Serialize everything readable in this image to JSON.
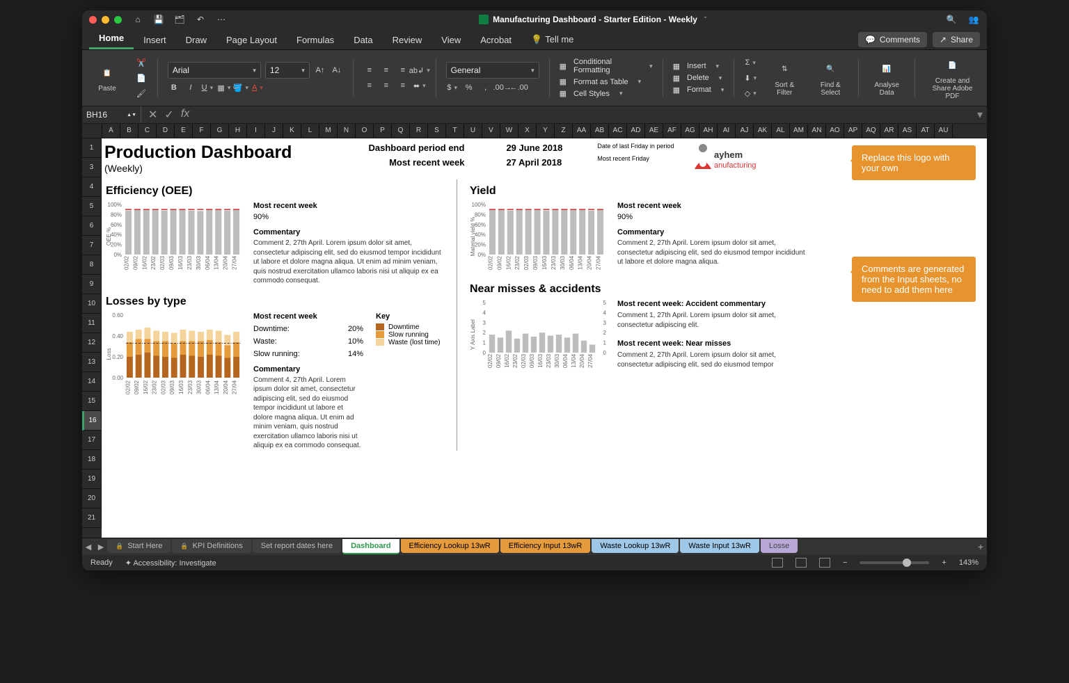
{
  "title_bar": {
    "doc_title": "Manufacturing Dashboard - Starter Edition - Weekly"
  },
  "ribbon_tabs": [
    "Home",
    "Insert",
    "Draw",
    "Page Layout",
    "Formulas",
    "Data",
    "Review",
    "View",
    "Acrobat",
    "Tell me"
  ],
  "ribbon": {
    "paste": "Paste",
    "font_name": "Arial",
    "font_size": "12",
    "number_format": "General",
    "cond_fmt": "Conditional Formatting",
    "fmt_table": "Format as Table",
    "cell_styles": "Cell Styles",
    "insert": "Insert",
    "delete": "Delete",
    "format": "Format",
    "sort_filter": "Sort & Filter",
    "find_select": "Find & Select",
    "analyse": "Analyse Data",
    "adobe": "Create and Share Adobe PDF",
    "comments_btn": "Comments",
    "share_btn": "Share"
  },
  "namebox": "BH16",
  "col_headers": [
    "A",
    "B",
    "C",
    "D",
    "E",
    "F",
    "G",
    "H",
    "I",
    "J",
    "K",
    "L",
    "M",
    "N",
    "O",
    "P",
    "Q",
    "R",
    "S",
    "T",
    "U",
    "V",
    "W",
    "X",
    "Y",
    "Z",
    "AA",
    "AB",
    "AC",
    "AD",
    "AE",
    "AF",
    "AG",
    "AH",
    "AI",
    "AJ",
    "AK",
    "AL",
    "AM",
    "AN",
    "AO",
    "AP",
    "AQ",
    "AR",
    "AS",
    "AT",
    "AU"
  ],
  "row_headers": [
    "1",
    "3",
    "4",
    "5",
    "6",
    "7",
    "8",
    "9",
    "10",
    "11",
    "12",
    "13",
    "14",
    "15",
    "16",
    "17",
    "18",
    "19",
    "20",
    "21"
  ],
  "dashboard": {
    "title": "Production Dashboard",
    "subtitle": "(Weekly)",
    "period_label": "Dashboard period end",
    "period_value": "29 June 2018",
    "period_note": "Date of last Friday in period",
    "recent_label": "Most recent week",
    "recent_value": "27 April 2018",
    "recent_note": "Most recent Friday",
    "logo_name": "ayhem",
    "logo_sub": "anufacturing",
    "callout_logo": "Replace this logo with your own",
    "callout_comments": "Comments are generated from the Input sheets, no need to add them here",
    "oee": {
      "title": "Efficiency (OEE)",
      "mrw_label": "Most recent week",
      "mrw_value": "90%",
      "cm_label": "Commentary",
      "cm_text": "Comment 2,  27th April. Lorem ipsum dolor sit amet, consectetur adipiscing elit, sed do eiusmod tempor incididunt ut labore et dolore magna aliqua. Ut enim ad minim veniam, quis nostrud exercitation ullamco laboris nisi ut aliquip ex ea commodo consequat."
    },
    "yield": {
      "title": "Yield",
      "mrw_label": "Most recent week",
      "mrw_value": "90%",
      "cm_label": "Commentary",
      "cm_text": "Comment 2,  27th April. Lorem ipsum dolor sit amet, consectetur adipiscing elit, sed do eiusmod tempor incididunt ut labore et dolore magna aliqua."
    },
    "losses": {
      "title": "Losses by type",
      "mrw_label": "Most recent week",
      "downtime_l": "Downtime:",
      "downtime_v": "20%",
      "waste_l": "Waste:",
      "waste_v": "10%",
      "slow_l": "Slow running:",
      "slow_v": "14%",
      "key_label": "Key",
      "key_downtime": "Downtime",
      "key_slow": "Slow running",
      "key_waste": "Waste (lost time)",
      "cm_label": "Commentary",
      "cm_text": "Comment 4,  27th April. Lorem ipsum dolor sit amet, consectetur adipiscing elit, sed do eiusmod tempor incididunt ut labore et dolore magna aliqua. Ut enim ad minim veniam, quis nostrud exercitation ullamco laboris nisi ut aliquip ex ea commodo consequat."
    },
    "near": {
      "title": "Near misses & accidents",
      "acc_label": "Most recent week: Accident commentary",
      "acc_text": "Comment 1, 27th April. Lorem ipsum dolor sit amet, consectetur adipiscing elit.",
      "nm_label": "Most recent week: Near misses",
      "nm_text": "Comment 2,  27th April. Lorem ipsum dolor sit amet, consectetur adipiscing elit, sed do eiusmod tempor"
    }
  },
  "chart_data": [
    {
      "type": "bar",
      "name": "oee",
      "ylabel": "OEE %",
      "categories": [
        "02/02",
        "09/02",
        "16/02",
        "23/02",
        "02/03",
        "09/03",
        "16/03",
        "23/03",
        "30/03",
        "06/04",
        "13/04",
        "20/04",
        "27/04"
      ],
      "values": [
        88,
        90,
        89,
        91,
        88,
        90,
        89,
        88,
        87,
        90,
        89,
        88,
        90
      ],
      "target": 90,
      "ylim": [
        0,
        100
      ],
      "yticks": [
        0,
        20,
        40,
        60,
        80,
        100
      ]
    },
    {
      "type": "bar",
      "name": "yield",
      "ylabel": "Material yield %",
      "categories": [
        "02/02",
        "09/02",
        "16/02",
        "23/02",
        "02/03",
        "09/03",
        "16/03",
        "23/03",
        "30/03",
        "06/04",
        "13/04",
        "20/04",
        "27/04"
      ],
      "values": [
        89,
        90,
        88,
        91,
        89,
        90,
        88,
        89,
        90,
        91,
        89,
        88,
        90
      ],
      "target": 90,
      "ylim": [
        0,
        100
      ],
      "yticks": [
        0,
        20,
        40,
        60,
        80,
        100
      ]
    },
    {
      "type": "bar",
      "name": "losses",
      "stacked": true,
      "ylabel": "Loss %",
      "categories": [
        "02/02",
        "09/02",
        "16/02",
        "23/02",
        "02/03",
        "09/03",
        "16/03",
        "23/03",
        "30/03",
        "06/04",
        "13/04",
        "20/04",
        "27/04"
      ],
      "series": [
        {
          "name": "Downtime",
          "color": "#b5651d",
          "values": [
            0.2,
            0.22,
            0.24,
            0.21,
            0.2,
            0.19,
            0.22,
            0.21,
            0.2,
            0.22,
            0.21,
            0.19,
            0.2
          ]
        },
        {
          "name": "Slow running",
          "color": "#e59a3c",
          "values": [
            0.14,
            0.15,
            0.13,
            0.14,
            0.15,
            0.14,
            0.13,
            0.14,
            0.15,
            0.14,
            0.13,
            0.12,
            0.14
          ]
        },
        {
          "name": "Waste (lost time)",
          "color": "#f5d49b",
          "values": [
            0.1,
            0.09,
            0.11,
            0.1,
            0.09,
            0.1,
            0.11,
            0.1,
            0.09,
            0.1,
            0.11,
            0.1,
            0.1
          ]
        }
      ],
      "ylim": [
        0,
        0.6
      ],
      "yticks": [
        0,
        0.2,
        0.4,
        0.6
      ]
    },
    {
      "type": "bar",
      "name": "near_misses",
      "ylabel": "Y Axis Label",
      "categories": [
        "02/02",
        "09/02",
        "16/02",
        "23/02",
        "02/03",
        "09/03",
        "16/03",
        "23/03",
        "30/03",
        "06/04",
        "13/04",
        "20/04",
        "27/04"
      ],
      "values": [
        1.8,
        1.5,
        2.2,
        1.4,
        1.9,
        1.6,
        2.0,
        1.7,
        1.8,
        1.5,
        1.9,
        1.2,
        0.8
      ],
      "ylim": [
        0,
        5
      ],
      "yticks": [
        0,
        1,
        2,
        3,
        4,
        5
      ],
      "yticks_right": [
        0,
        1,
        2,
        3,
        4,
        5
      ]
    }
  ],
  "sheet_tabs": [
    {
      "label": "Start Here",
      "locked": true,
      "bg": "#3f3f3f",
      "fg": "#bbb"
    },
    {
      "label": "KPI Definitions",
      "locked": true,
      "bg": "#3f3f3f",
      "fg": "#bbb"
    },
    {
      "label": "Set report dates here",
      "locked": false,
      "bg": "#3f3f3f",
      "fg": "#bbb"
    },
    {
      "label": "Dashboard",
      "locked": false,
      "bg": "#fff",
      "fg": "#2e9a4f",
      "active": true
    },
    {
      "label": "Efficiency Lookup 13wR",
      "locked": false,
      "bg": "#e59a3c",
      "fg": "#000"
    },
    {
      "label": "Efficiency Input  13wR",
      "locked": false,
      "bg": "#e59a3c",
      "fg": "#000"
    },
    {
      "label": "Waste Lookup 13wR",
      "locked": false,
      "bg": "#9ec7e8",
      "fg": "#000"
    },
    {
      "label": "Waste Input 13wR",
      "locked": false,
      "bg": "#9ec7e8",
      "fg": "#000"
    },
    {
      "label": "Losse",
      "locked": false,
      "bg": "#b8a8d8",
      "fg": "#444"
    }
  ],
  "status": {
    "ready": "Ready",
    "access": "Accessibility: Investigate",
    "zoom": "143%"
  }
}
